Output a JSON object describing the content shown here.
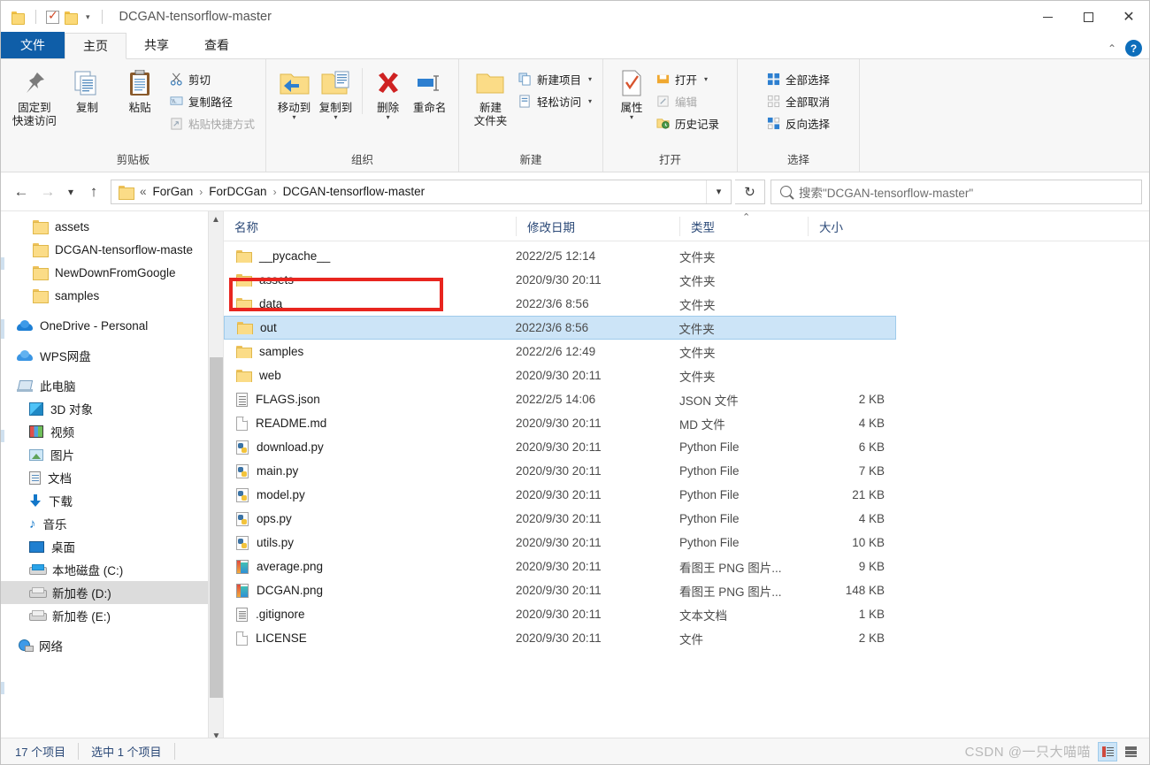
{
  "titlebar": {
    "title": "DCGAN-tensorflow-master",
    "quick_access_icons": [
      "folder-icon",
      "properties-check-icon",
      "new-folder-icon",
      "chevron-down-icon"
    ],
    "minimize": "—",
    "maximize": "□",
    "close": "✕"
  },
  "tabs": {
    "file": "文件",
    "items": [
      "主页",
      "共享",
      "查看"
    ],
    "active_index": 0,
    "help": "?",
    "collapse": "⌃"
  },
  "ribbon": {
    "groups": [
      {
        "label": "剪贴板",
        "big": [
          {
            "label_line1": "固定到",
            "label_line2": "快速访问",
            "icon": "pin-icon"
          },
          {
            "label_line1": "复制",
            "label_line2": "",
            "icon": "copy-icon"
          },
          {
            "label_line1": "粘贴",
            "label_line2": "",
            "icon": "paste-icon"
          }
        ],
        "small": [
          {
            "label": "剪切",
            "icon": "scissors-icon",
            "disabled": false
          },
          {
            "label": "复制路径",
            "icon": "copy-path-icon",
            "disabled": false
          },
          {
            "label": "粘贴快捷方式",
            "icon": "paste-shortcut-icon",
            "disabled": true
          }
        ]
      },
      {
        "label": "组织",
        "big": [
          {
            "label_line1": "移动到",
            "label_line2": "",
            "icon": "move-to-icon",
            "dropdown": true
          },
          {
            "label_line1": "复制到",
            "label_line2": "",
            "icon": "copy-to-icon",
            "dropdown": true
          },
          {
            "label_line1": "删除",
            "label_line2": "",
            "icon": "delete-icon",
            "dropdown": true
          },
          {
            "label_line1": "重命名",
            "label_line2": "",
            "icon": "rename-icon"
          }
        ],
        "small": []
      },
      {
        "label": "新建",
        "big": [
          {
            "label_line1": "新建",
            "label_line2": "文件夹",
            "icon": "new-folder-icon"
          }
        ],
        "small": [
          {
            "label": "新建项目",
            "icon": "new-item-icon",
            "dropdown": true,
            "disabled": false
          },
          {
            "label": "轻松访问",
            "icon": "easy-access-icon",
            "dropdown": true,
            "disabled": false
          }
        ]
      },
      {
        "label": "打开",
        "big": [
          {
            "label_line1": "属性",
            "label_line2": "",
            "icon": "properties-icon",
            "dropdown": true
          }
        ],
        "small": [
          {
            "label": "打开",
            "icon": "open-icon",
            "dropdown": true,
            "disabled": false
          },
          {
            "label": "编辑",
            "icon": "edit-icon",
            "disabled": true
          },
          {
            "label": "历史记录",
            "icon": "history-icon",
            "disabled": false
          }
        ]
      },
      {
        "label": "选择",
        "big": [],
        "small": [
          {
            "label": "全部选择",
            "icon": "select-all-icon",
            "disabled": false
          },
          {
            "label": "全部取消",
            "icon": "select-none-icon",
            "disabled": false
          },
          {
            "label": "反向选择",
            "icon": "invert-selection-icon",
            "disabled": false
          }
        ]
      }
    ]
  },
  "addressbar": {
    "back": "←",
    "forward": "→",
    "recent": "⌄",
    "up": "↑",
    "prefix": "«",
    "crumbs": [
      "ForGan",
      "ForDCGan",
      "DCGAN-tensorflow-master"
    ],
    "separator": "›",
    "dropdown": "⌄",
    "refresh": "↻",
    "search_placeholder": "搜索\"DCGAN-tensorflow-master\""
  },
  "sidebar": {
    "items": [
      {
        "label": "assets",
        "icon": "folder-icon",
        "indent": 1,
        "selected": false
      },
      {
        "label": "DCGAN-tensorflow-maste",
        "icon": "folder-icon",
        "indent": 1,
        "selected": false
      },
      {
        "label": "NewDownFromGoogle",
        "icon": "folder-icon",
        "indent": 1,
        "selected": false
      },
      {
        "label": "samples",
        "icon": "folder-icon",
        "indent": 1,
        "selected": false
      },
      {
        "label": "OneDrive - Personal",
        "icon": "onedrive-icon",
        "indent": 0,
        "selected": false,
        "gap_before": true
      },
      {
        "label": "WPS网盘",
        "icon": "wps-cloud-icon",
        "indent": 0,
        "selected": false,
        "gap_before": true
      },
      {
        "label": "此电脑",
        "icon": "this-pc-icon",
        "indent": 0,
        "selected": false,
        "gap_before": true
      },
      {
        "label": "3D 对象",
        "icon": "3d-objects-icon",
        "indent": 2,
        "selected": false
      },
      {
        "label": "视频",
        "icon": "videos-icon",
        "indent": 2,
        "selected": false
      },
      {
        "label": "图片",
        "icon": "pictures-icon",
        "indent": 2,
        "selected": false
      },
      {
        "label": "文档",
        "icon": "documents-icon",
        "indent": 2,
        "selected": false
      },
      {
        "label": "下载",
        "icon": "downloads-icon",
        "indent": 2,
        "selected": false
      },
      {
        "label": "音乐",
        "icon": "music-icon",
        "indent": 2,
        "selected": false
      },
      {
        "label": "桌面",
        "icon": "desktop-icon",
        "indent": 2,
        "selected": false
      },
      {
        "label": "本地磁盘 (C:)",
        "icon": "windows-drive-icon",
        "indent": 2,
        "selected": false
      },
      {
        "label": "新加卷 (D:)",
        "icon": "drive-icon",
        "indent": 2,
        "selected": true
      },
      {
        "label": "新加卷 (E:)",
        "icon": "drive-icon",
        "indent": 2,
        "selected": false
      },
      {
        "label": "网络",
        "icon": "network-icon",
        "indent": 0,
        "selected": false,
        "gap_before": true
      }
    ]
  },
  "filelist": {
    "columns": [
      "名称",
      "修改日期",
      "类型",
      "大小"
    ],
    "sort_indicator": "⌃",
    "rows": [
      {
        "name": "__pycache__",
        "date": "2022/2/5 12:14",
        "type": "文件夹",
        "size": "",
        "icon": "folder-icon",
        "selected": false
      },
      {
        "name": "assets",
        "date": "2020/9/30 20:11",
        "type": "文件夹",
        "size": "",
        "icon": "folder-icon",
        "selected": false
      },
      {
        "name": "data",
        "date": "2022/3/6 8:56",
        "type": "文件夹",
        "size": "",
        "icon": "folder-icon",
        "selected": false
      },
      {
        "name": "out",
        "date": "2022/3/6 8:56",
        "type": "文件夹",
        "size": "",
        "icon": "folder-icon",
        "selected": true
      },
      {
        "name": "samples",
        "date": "2022/2/6 12:49",
        "type": "文件夹",
        "size": "",
        "icon": "folder-icon",
        "selected": false
      },
      {
        "name": "web",
        "date": "2020/9/30 20:11",
        "type": "文件夹",
        "size": "",
        "icon": "folder-icon",
        "selected": false
      },
      {
        "name": "FLAGS.json",
        "date": "2022/2/5 14:06",
        "type": "JSON 文件",
        "size": "2 KB",
        "icon": "json-file-icon",
        "selected": false
      },
      {
        "name": "README.md",
        "date": "2020/9/30 20:11",
        "type": "MD 文件",
        "size": "4 KB",
        "icon": "file-icon",
        "selected": false
      },
      {
        "name": "download.py",
        "date": "2020/9/30 20:11",
        "type": "Python File",
        "size": "6 KB",
        "icon": "python-file-icon",
        "selected": false
      },
      {
        "name": "main.py",
        "date": "2020/9/30 20:11",
        "type": "Python File",
        "size": "7 KB",
        "icon": "python-file-icon",
        "selected": false
      },
      {
        "name": "model.py",
        "date": "2020/9/30 20:11",
        "type": "Python File",
        "size": "21 KB",
        "icon": "python-file-icon",
        "selected": false
      },
      {
        "name": "ops.py",
        "date": "2020/9/30 20:11",
        "type": "Python File",
        "size": "4 KB",
        "icon": "python-file-icon",
        "selected": false
      },
      {
        "name": "utils.py",
        "date": "2020/9/30 20:11",
        "type": "Python File",
        "size": "10 KB",
        "icon": "python-file-icon",
        "selected": false
      },
      {
        "name": "average.png",
        "date": "2020/9/30 20:11",
        "type": "看图王 PNG 图片...",
        "size": "9 KB",
        "icon": "png-file-icon",
        "selected": false
      },
      {
        "name": "DCGAN.png",
        "date": "2020/9/30 20:11",
        "type": "看图王 PNG 图片...",
        "size": "148 KB",
        "icon": "png-file-icon",
        "selected": false
      },
      {
        "name": ".gitignore",
        "date": "2020/9/30 20:11",
        "type": "文本文档",
        "size": "1 KB",
        "icon": "text-file-icon",
        "selected": false
      },
      {
        "name": "LICENSE",
        "date": "2020/9/30 20:11",
        "type": "文件",
        "size": "2 KB",
        "icon": "file-icon",
        "selected": false
      }
    ],
    "annotation_color": "#e8251f"
  },
  "statusbar": {
    "item_count": "17 个项目",
    "selection": "选中 1 个项目",
    "watermark": "CSDN @一只大喵喵",
    "views": [
      "details-view-icon",
      "large-icons-view-icon"
    ]
  }
}
